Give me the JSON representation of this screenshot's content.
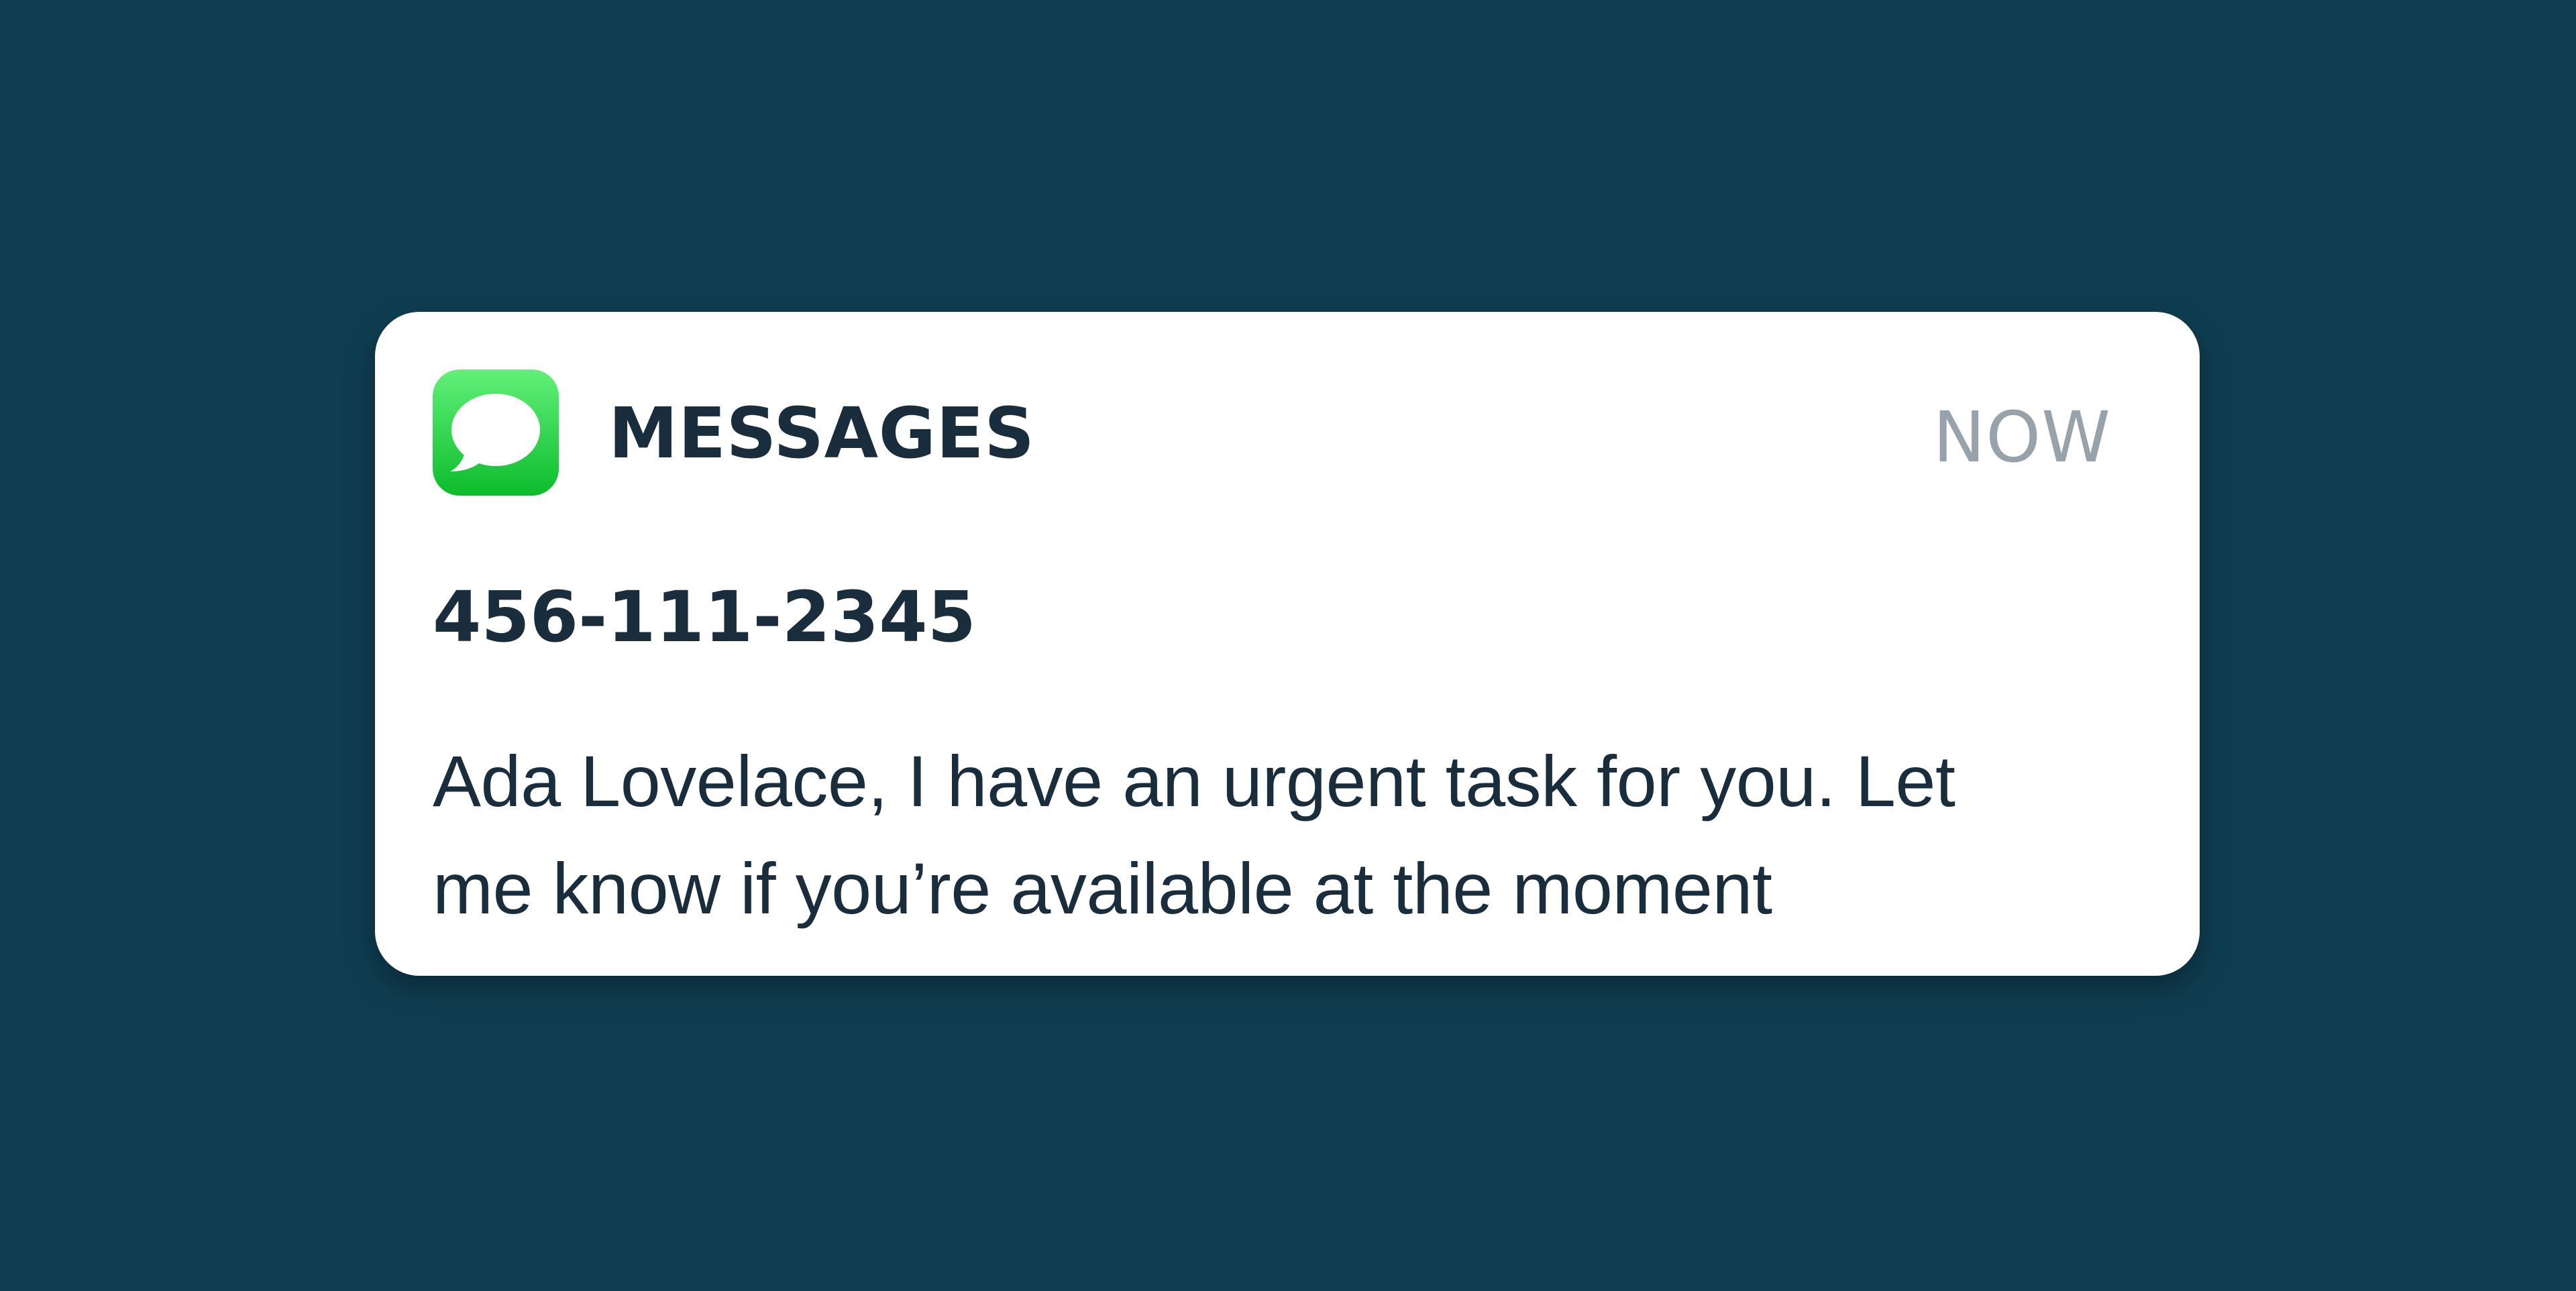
{
  "notification": {
    "app_icon": "messages-speech-bubble-icon",
    "app_name": "MESSAGES",
    "timestamp": "NOW",
    "sender": "456-111-2345",
    "message": "Ada Lovelace, I have an urgent task for you. Let me know if you’re available at the moment"
  },
  "colors": {
    "background": "#0f3e51",
    "card": "#ffffff",
    "icon_top": "#62f07a",
    "icon_bottom": "#0cbc2c",
    "primary_text": "#1a2d3d",
    "secondary_text": "#97a2ab"
  }
}
